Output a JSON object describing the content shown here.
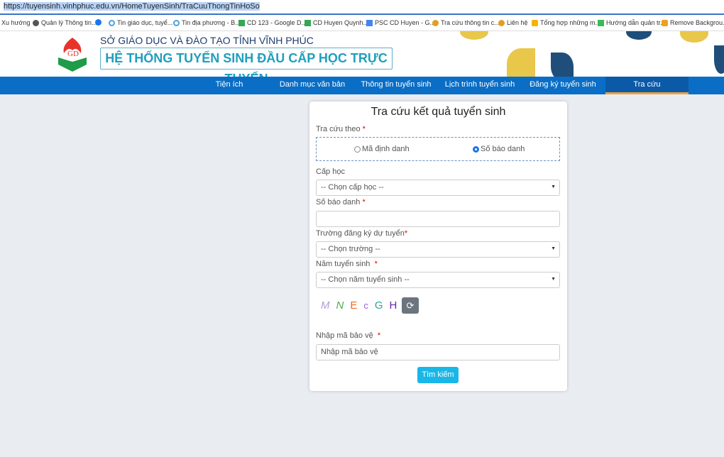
{
  "browser": {
    "url": "https://tuyensinh.vinhphuc.edu.vn/HomeTuyenSinh/TraCuuThongTinHoSo",
    "bookmarks": [
      "Xu hướng",
      "Quản lý Thông tin...",
      "",
      "Tin giáo dục, tuyể...",
      "Tin địa phương - B...",
      "CD 123 - Google D...",
      "CD Huyen Quynh...",
      "PSC CD Huyen - G...",
      "Tra cứu thông tin c...",
      "Liên hệ",
      "Tổng hợp những m...",
      "Hướng dẫn quản tr...",
      "Remove Backgrou..."
    ]
  },
  "header": {
    "subtitle": "SỞ GIÁO DỤC VÀ ĐÀO TẠO TỈNH VĨNH PHÚC",
    "title": "HỆ THỐNG TUYỂN SINH ĐẦU CẤP HỌC TRỰC TUYẾN"
  },
  "nav": [
    "Tiện ích",
    "Danh mục văn bản",
    "Thông tin tuyển sinh",
    "Lịch trình tuyển sinh",
    "Đăng ký tuyển sinh",
    "Tra cứu"
  ],
  "form": {
    "title": "Tra cứu kết quả tuyển sinh",
    "search_by_label": "Tra cứu theo",
    "required": "*",
    "option1": "Mã định danh",
    "option2": "Số báo danh",
    "selected": "Số báo danh",
    "level_label": "Cấp học",
    "level_value": "-- Chọn cấp học --",
    "sbd_label": "Số báo danh",
    "sbd_value": "",
    "school_label": "Trường đăng ký dự tuyển",
    "school_value": "-- Chọn trường --",
    "year_label": "Năm tuyển sinh",
    "year_value": "-- Chọn năm tuyển sinh --",
    "captcha": [
      "M",
      "N",
      "E",
      "c",
      "G",
      "H"
    ],
    "captcha_label": "Nhập mã bảo vệ",
    "captcha_placeholder": "Nhập mã bảo vệ",
    "submit": "Tìm kiếm"
  },
  "colors": {
    "nav": "#0a6ec6",
    "accent": "#19b7e8",
    "title": "#1f9fbe"
  }
}
